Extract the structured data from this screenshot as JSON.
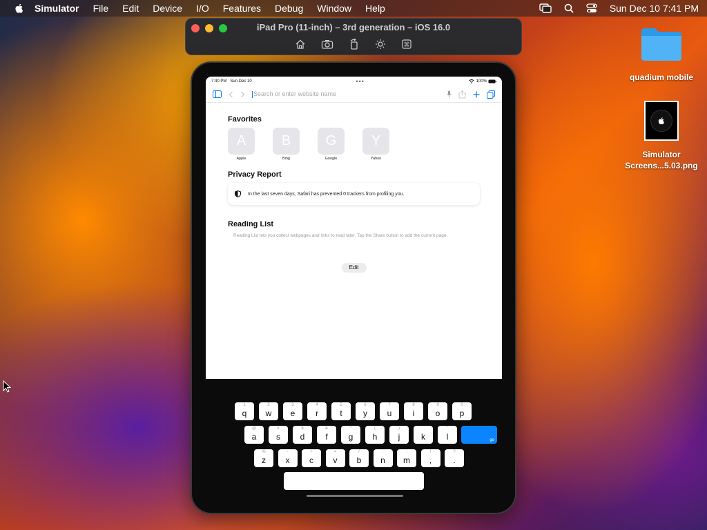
{
  "menubar": {
    "app": "Simulator",
    "items": [
      "File",
      "Edit",
      "Device",
      "I/O",
      "Features",
      "Debug",
      "Window",
      "Help"
    ],
    "datetime": "Sun Dec 10  7:41 PM"
  },
  "sim_window": {
    "title": "iPad Pro (11-inch) – 3rd generation – iOS 16.0",
    "toolbar_icons": [
      "home-icon",
      "screenshot-icon",
      "rotate-icon",
      "appearance-icon",
      "command-icon"
    ]
  },
  "desktop": {
    "folder": "quadium mobile",
    "file_line1": "Simulator",
    "file_line2": "Screens...5.03.png"
  },
  "ipad": {
    "status": {
      "time": "7:40 PM",
      "date": "Sun Dec 10",
      "battery": "100%"
    },
    "url_placeholder": "Search or enter website name",
    "favorites_title": "Favorites",
    "favorites": [
      {
        "letter": "A",
        "label": "Apple"
      },
      {
        "letter": "B",
        "label": "Bing"
      },
      {
        "letter": "G",
        "label": "Google"
      },
      {
        "letter": "Y",
        "label": "Yahoo"
      }
    ],
    "privacy_title": "Privacy Report",
    "privacy_text": "In the last seven days, Safari has prevented 0 trackers from profiling you.",
    "reading_title": "Reading List",
    "reading_text": "Reading List lets you collect webpages and links to read later. Tap the Share button to add the current page.",
    "edit_label": "Edit",
    "keyboard": {
      "row1": [
        [
          "q",
          "1"
        ],
        [
          "w",
          "2"
        ],
        [
          "e",
          "3"
        ],
        [
          "r",
          "4"
        ],
        [
          "t",
          "5"
        ],
        [
          "y",
          "6"
        ],
        [
          "u",
          "7"
        ],
        [
          "i",
          "8"
        ],
        [
          "o",
          "9"
        ],
        [
          "p",
          "0"
        ]
      ],
      "row2": [
        [
          "a",
          "@"
        ],
        [
          "s",
          "#"
        ],
        [
          "d",
          "$"
        ],
        [
          "f",
          "&"
        ],
        [
          "g",
          "*"
        ],
        [
          "h",
          "("
        ],
        [
          "j",
          ")"
        ],
        [
          "k",
          "'"
        ],
        [
          "l",
          "\""
        ]
      ],
      "row3": [
        [
          "z",
          "%"
        ],
        [
          "x",
          "-"
        ],
        [
          "c",
          "+"
        ],
        [
          "v",
          "="
        ],
        [
          "b",
          "/"
        ],
        [
          "n",
          ";"
        ],
        [
          "m",
          ":"
        ],
        [
          ",",
          "!"
        ],
        [
          ".",
          "?"
        ]
      ],
      "go_label": "go"
    }
  }
}
